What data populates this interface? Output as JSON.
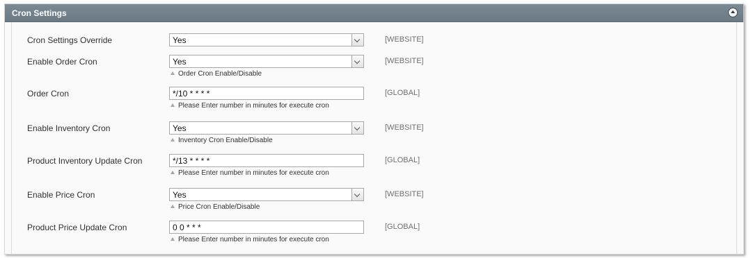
{
  "panel": {
    "title": "Cron Settings",
    "collapse_icon": "circle-up-arrow-icon"
  },
  "rows": [
    {
      "label": "Cron Settings Override",
      "type": "select",
      "value": "Yes",
      "scope": "[WEBSITE]",
      "note": ""
    },
    {
      "label": "Enable Order Cron",
      "type": "select",
      "value": "Yes",
      "scope": "[WEBSITE]",
      "note": "Order Cron Enable/Disable"
    },
    {
      "label": "Order Cron",
      "type": "text",
      "value": "*/10 * * * *",
      "scope": "[GLOBAL]",
      "note": "Please Enter number in minutes for execute cron"
    },
    {
      "label": "Enable Inventory Cron",
      "type": "select",
      "value": "Yes",
      "scope": "[WEBSITE]",
      "note": "Inventory Cron Enable/Disable"
    },
    {
      "label": "Product Inventory Update Cron",
      "type": "text",
      "value": "*/13 * * * *",
      "scope": "[GLOBAL]",
      "note": "Please Enter number in minutes for execute cron"
    },
    {
      "label": "Enable Price Cron",
      "type": "select",
      "value": "Yes",
      "scope": "[WEBSITE]",
      "note": "Price Cron Enable/Disable"
    },
    {
      "label": "Product Price Update Cron",
      "type": "text",
      "value": "0 0 * * *",
      "scope": "[GLOBAL]",
      "note": "Please Enter number in minutes for execute cron"
    }
  ]
}
